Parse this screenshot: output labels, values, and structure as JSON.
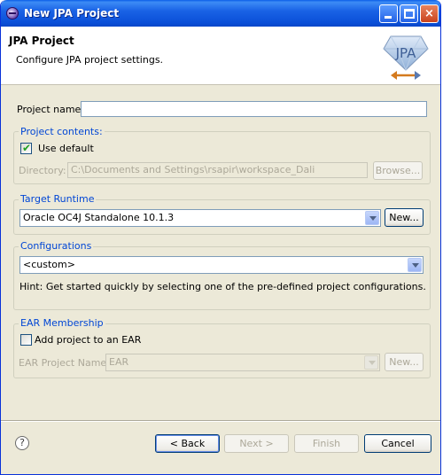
{
  "window": {
    "title": "New JPA Project",
    "controls": {
      "minimize": "minimize",
      "maximize": "maximize",
      "close": "×"
    }
  },
  "banner": {
    "title": "JPA Project",
    "subtitle": "Configure JPA project settings.",
    "logo_text": "JPA"
  },
  "project_name": {
    "label": "Project name:",
    "value": ""
  },
  "project_contents": {
    "group_title": "Project contents:",
    "use_default_label": "Use default",
    "use_default_checked": true,
    "directory_label": "Directory:",
    "directory_value": "C:\\Documents and Settings\\rsapir\\workspace_Dali",
    "browse_label": "Browse..."
  },
  "target_runtime": {
    "group_title": "Target Runtime",
    "selected": "Oracle OC4J Standalone 10.1.3",
    "new_label": "New..."
  },
  "configurations": {
    "group_title": "Configurations",
    "selected": "<custom>",
    "hint": "Hint: Get started quickly by selecting one of the pre-defined project configurations."
  },
  "ear_membership": {
    "group_title": "EAR Membership",
    "add_label": "Add project to an EAR",
    "add_checked": false,
    "ear_name_label": "EAR Project Name:",
    "ear_name_value": "EAR",
    "new_label": "New..."
  },
  "footer": {
    "help_icon": "?",
    "back_label": "< Back",
    "next_label": "Next >",
    "finish_label": "Finish",
    "cancel_label": "Cancel"
  },
  "colors": {
    "titlebar": "#0a4fd8",
    "group_title": "#0046d5",
    "dialog_bg": "#ece9d8"
  }
}
